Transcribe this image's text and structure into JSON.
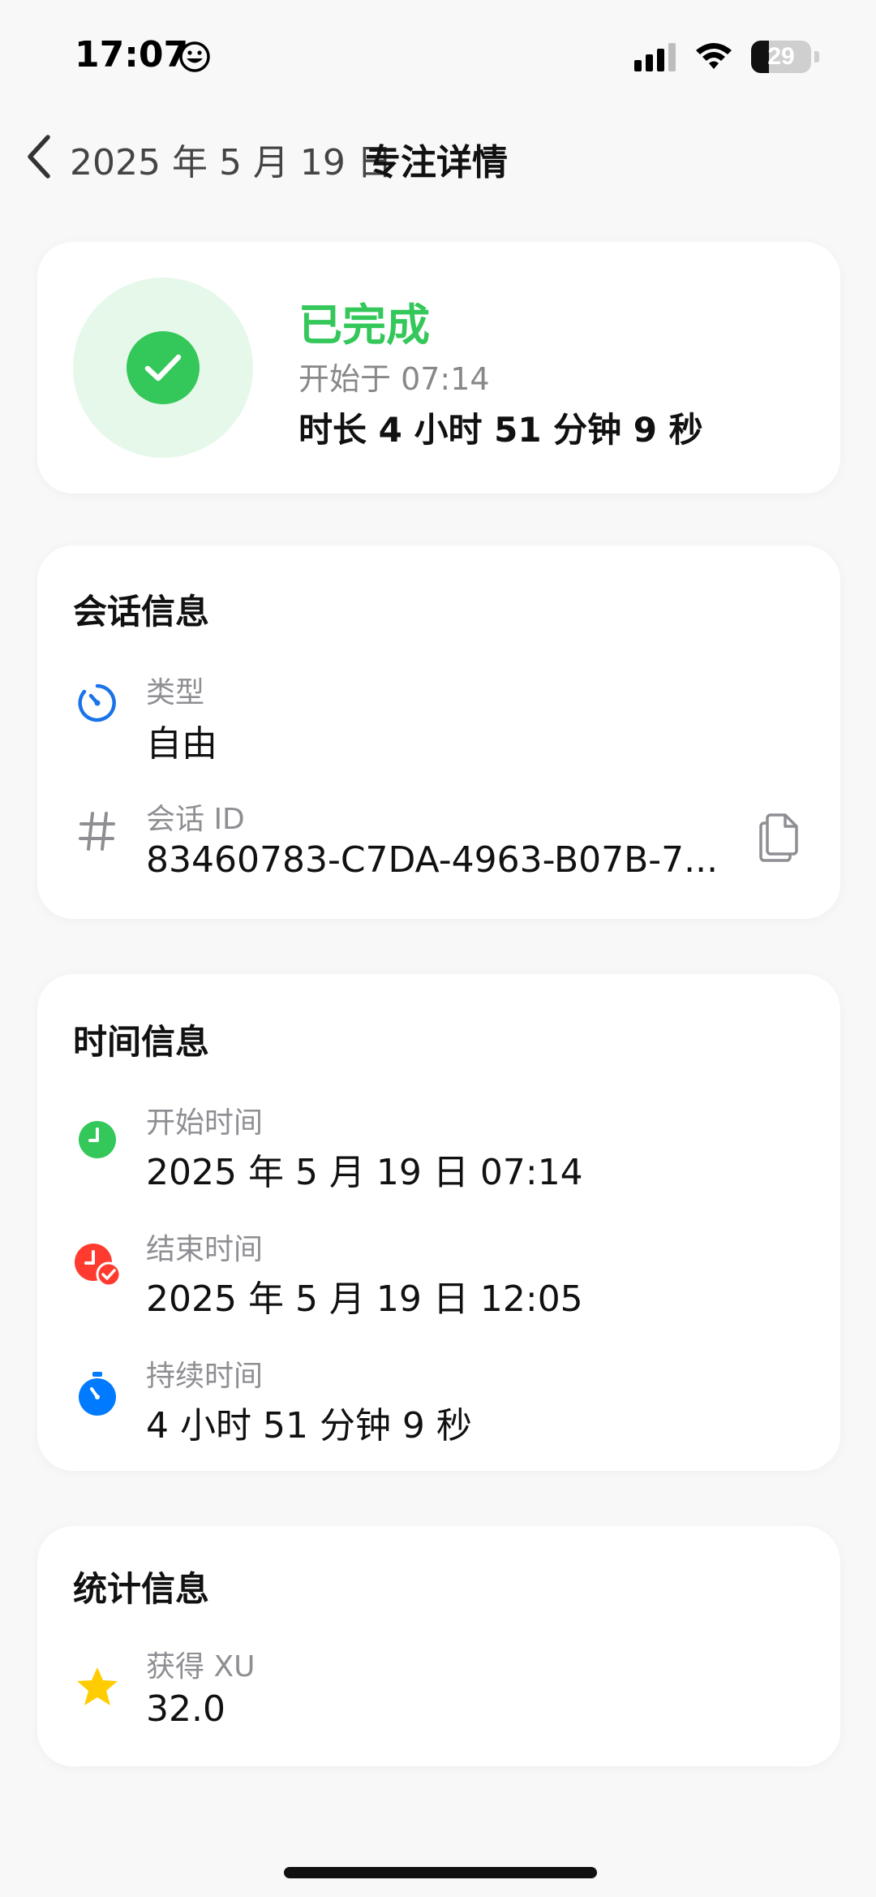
{
  "status_bar": {
    "time": "17:07",
    "battery": "29",
    "icons": [
      "smiley-icon",
      "cellular-signal-icon",
      "wifi-icon",
      "battery-icon"
    ]
  },
  "nav": {
    "back_label": "2025 年 5 月 19 日",
    "title": "专注详情",
    "back_icon": "chevron-left-icon"
  },
  "summary": {
    "status": "已完成",
    "start": "开始于 07:14",
    "duration": "时长 4 小时 51 分钟 9 秒",
    "status_color": "#34c759",
    "icon": "check-circle-icon"
  },
  "session_info": {
    "title": "会话信息",
    "type_label": "类型",
    "type_value": "自由",
    "id_label": "会话 ID",
    "id_value": "83460783-C7DA-4963-B07B-7...",
    "icons": [
      "timer-icon",
      "hash-icon",
      "copy-icon"
    ]
  },
  "time_info": {
    "title": "时间信息",
    "start_label": "开始时间",
    "start_value": "2025 年 5 月 19 日 07:14",
    "end_label": "结束时间",
    "end_value": "2025 年 5 月 19 日 12:05",
    "duration_label": "持续时间",
    "duration_value": "4 小时 51 分钟 9 秒",
    "colors": {
      "start": "#34c759",
      "end": "#ff3b30",
      "duration": "#007aff"
    }
  },
  "stats_info": {
    "title": "统计信息",
    "xu_label": "获得 XU",
    "xu_value": "32.0",
    "star_color": "#ffcc00"
  }
}
